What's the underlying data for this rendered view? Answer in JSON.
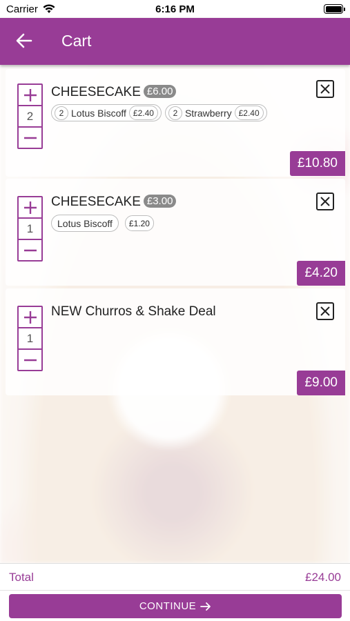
{
  "status_bar": {
    "carrier": "Carrier",
    "time": "6:16 PM"
  },
  "header": {
    "title": "Cart"
  },
  "colors": {
    "primary": "#983c96",
    "price_badge": "#8a8a8a"
  },
  "items": [
    {
      "name": "CHEESECAKE",
      "unit_price": "£6.00",
      "quantity": "2",
      "options": [
        {
          "qty": "2",
          "label": "Lotus Biscoff",
          "price": "£2.40"
        },
        {
          "qty": "2",
          "label": "Strawberry",
          "price": "£2.40"
        }
      ],
      "total": "£10.80"
    },
    {
      "name": "CHEESECAKE",
      "unit_price": "£3.00",
      "quantity": "1",
      "options": [
        {
          "label": "Lotus Biscoff",
          "price": "£1.20"
        }
      ],
      "total": "£4.20"
    },
    {
      "name": "NEW Churros & Shake Deal",
      "quantity": "1",
      "total": "£9.00"
    }
  ],
  "footer": {
    "total_label": "Total",
    "total_value": "£24.00",
    "continue_label": "CONTINUE"
  }
}
